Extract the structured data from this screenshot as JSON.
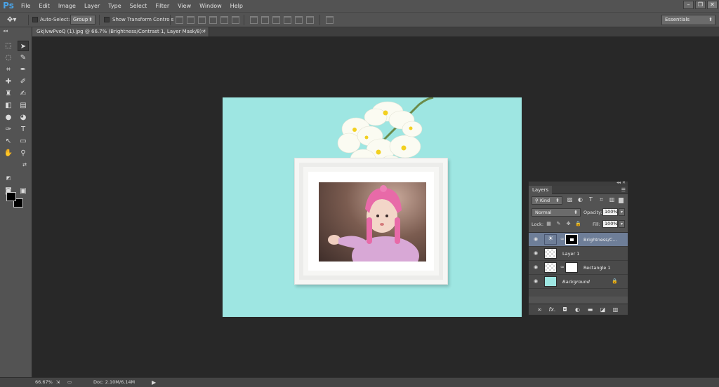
{
  "app": {
    "logo": "Ps"
  },
  "menu": [
    "File",
    "Edit",
    "Image",
    "Layer",
    "Type",
    "Select",
    "Filter",
    "View",
    "Window",
    "Help"
  ],
  "window_controls": {
    "minimize": "–",
    "restore": "❐",
    "close": "✕"
  },
  "options_bar": {
    "tool_icon": "move-icon",
    "auto_select_label": "Auto-Select:",
    "auto_select_value": "Group",
    "transform_controls_label": "Show Transform Controls",
    "workspace": "Essentials"
  },
  "document_tab": {
    "title": "GkjlvwPvoQ (1).jpg @ 66.7% (Brightness/Contrast 1, Layer Mask/8) *",
    "close": "×"
  },
  "tools": [
    "marquee-tool",
    "move-tool",
    "lasso-tool",
    "quick-select-tool",
    "crop-tool",
    "eyedropper-tool",
    "spot-heal-tool",
    "brush-tool",
    "clone-stamp-tool",
    "history-brush-tool",
    "eraser-tool",
    "gradient-tool",
    "blur-tool",
    "dodge-tool",
    "pen-tool",
    "type-tool",
    "path-select-tool",
    "rectangle-tool",
    "hand-tool",
    "zoom-tool"
  ],
  "colors": {
    "foreground": "#000000",
    "background": "#000000",
    "canvas_bg": "#9ee6e2",
    "layer_selected": "#6e7e98"
  },
  "layers_panel": {
    "tab": "Layers",
    "filter_kind": "Kind",
    "blend_mode": "Normal",
    "opacity_label": "Opacity:",
    "opacity_value": "100%",
    "lock_label": "Lock:",
    "fill_label": "Fill:",
    "fill_value": "100%",
    "layers": [
      {
        "name": "Brightness/C...",
        "type": "adjustment",
        "selected": true,
        "visible": true
      },
      {
        "name": "Layer 1",
        "type": "pixel",
        "selected": false,
        "visible": true
      },
      {
        "name": "Rectangle 1",
        "type": "shape",
        "selected": false,
        "visible": true
      },
      {
        "name": "Background",
        "type": "background",
        "selected": false,
        "visible": true,
        "locked": true
      }
    ],
    "bottom_icons": [
      "link-icon",
      "fx-icon",
      "mask-icon",
      "adjustment-icon",
      "group-icon",
      "new-layer-icon",
      "trash-icon"
    ],
    "fx_label": "fx."
  },
  "status_bar": {
    "zoom": "66.67%",
    "doc": "Doc: 2.10M/6.14M"
  }
}
